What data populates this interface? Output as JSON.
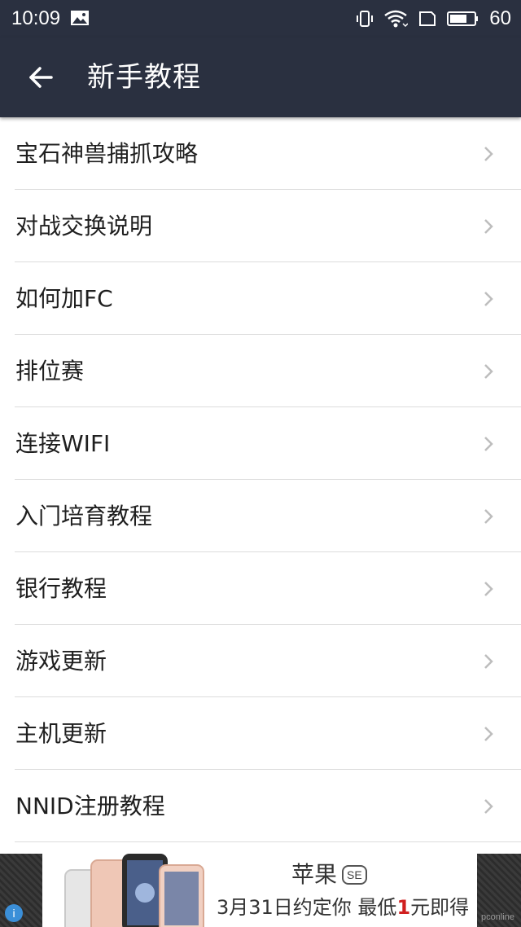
{
  "status_bar": {
    "time": "10:09",
    "battery": "60"
  },
  "header": {
    "title": "新手教程"
  },
  "menu_items": [
    {
      "label": "宝石神兽捕抓攻略"
    },
    {
      "label": "对战交换说明"
    },
    {
      "label": "如何加FC"
    },
    {
      "label": "排位赛"
    },
    {
      "label": "连接WIFI"
    },
    {
      "label": "入门培育教程"
    },
    {
      "label": "银行教程"
    },
    {
      "label": "游戏更新"
    },
    {
      "label": "主机更新"
    },
    {
      "label": "NNID注册教程"
    }
  ],
  "ad": {
    "brand": "苹果",
    "badge": "SE",
    "tagline_prefix": "3月31日约定你 最低",
    "tagline_highlight": "1",
    "tagline_suffix": "元即得",
    "watermark": "pconline"
  },
  "colors": {
    "app_bar": "#2a3040",
    "divider": "#dcdcdc",
    "text": "#1f1f1f",
    "chevron": "#bdbdbd"
  }
}
